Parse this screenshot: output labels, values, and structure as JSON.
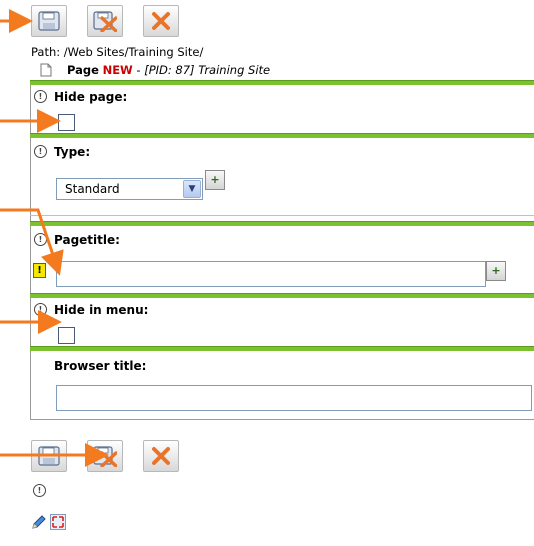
{
  "toolbar_top": {
    "save_label": "Save",
    "save_close_label": "Save and close",
    "close_label": "Close"
  },
  "path_line": "Path: /Web Sites/Training Site/",
  "doc": {
    "type": "Page",
    "new_label": "NEW",
    "sep": " - ",
    "pid_text": "[PID: 87]",
    "site": " Training Site"
  },
  "fields": {
    "hide_page": {
      "label": "Hide page:"
    },
    "type": {
      "label": "Type:",
      "value": "Standard"
    },
    "pagetitle": {
      "label": "Pagetitle:",
      "value": ""
    },
    "hide_in_menu": {
      "label": "Hide in menu:"
    },
    "browser_title": {
      "label": "Browser title:",
      "value": ""
    }
  },
  "help_glyph": "!",
  "colors": {
    "accent_green": "#7cc230",
    "arrow_orange": "#f47a20",
    "new_red": "#cc0000",
    "required_yellow": "#f4e800"
  },
  "icons": [
    "save-icon",
    "save-close-icon",
    "close-icon",
    "page-icon",
    "help-icon",
    "wizard-icon",
    "required-icon",
    "edit-icon",
    "fullscreen-icon",
    "dropdown-arrow-icon"
  ]
}
